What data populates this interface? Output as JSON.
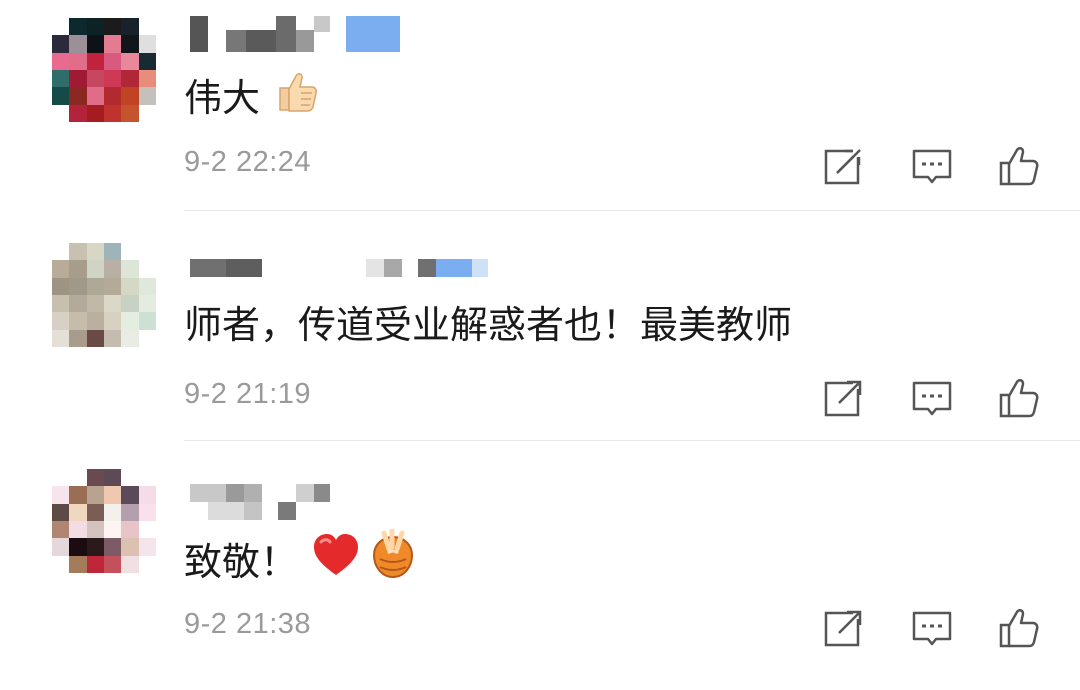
{
  "comments": [
    {
      "text": "伟大",
      "emoji": [
        "thumbs-up"
      ],
      "time": "9-2 22:24",
      "actions": [
        "share-icon",
        "reply-icon",
        "like-icon"
      ]
    },
    {
      "text": "师者，传道受业解惑者也！最美教师",
      "emoji": [],
      "time": "9-2 21:19",
      "actions": [
        "share-icon",
        "reply-icon",
        "like-icon"
      ]
    },
    {
      "text": "致敬！",
      "emoji": [
        "red-heart",
        "clapping-hands"
      ],
      "time": "9-2 21:38",
      "actions": [
        "share-icon",
        "reply-icon",
        "like-icon"
      ]
    }
  ],
  "colors": {
    "text": "#1a1a1a",
    "meta": "#9a9a9a",
    "icon": "#555555",
    "divider": "#e8e8e8",
    "vip_badge": "#7aaef0"
  }
}
